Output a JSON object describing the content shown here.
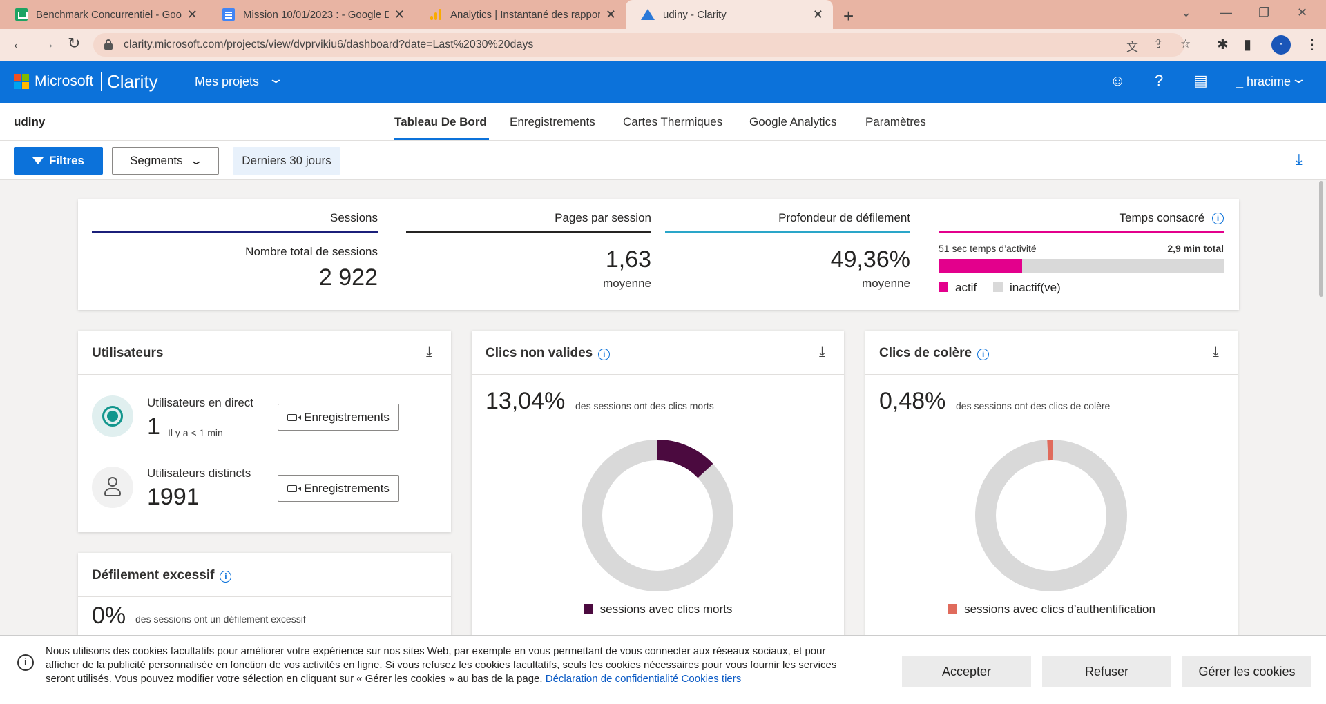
{
  "browser": {
    "tabs": [
      {
        "title": "Benchmark Concurrentiel - Goog",
        "icon": "sheets-icon"
      },
      {
        "title": "Mission 10/01/2023 : - Google D",
        "icon": "docs-icon"
      },
      {
        "title": "Analytics | Instantané des rappor",
        "icon": "analytics-icon"
      },
      {
        "title": "udiny - Clarity",
        "icon": "clarity-icon"
      }
    ],
    "url": "clarity.microsoft.com/projects/view/dvprvikiu6/dashboard?date=Last%2030%20days",
    "profile_initial": "-"
  },
  "header": {
    "brand": "Microsoft",
    "product": "Clarity",
    "projects_menu": "Mes projets",
    "user": "_ hracime"
  },
  "project": {
    "name": "udiny",
    "tabs": [
      "Tableau De Bord",
      "Enregistrements",
      "Cartes Thermiques",
      "Google Analytics",
      "Paramètres"
    ],
    "active_tab": "Tableau De Bord"
  },
  "filters": {
    "filter_label": "Filtres",
    "segments_label": "Segments",
    "date_range": "Derniers 30 jours"
  },
  "summary": {
    "sessions": {
      "title": "Sessions",
      "subtitle": "Nombre total de sessions",
      "value": "2 922"
    },
    "pages_per_session": {
      "title": "Pages par session",
      "value": "1,63",
      "caption": "moyenne"
    },
    "scroll_depth": {
      "title": "Profondeur de défilement",
      "value": "49,36%",
      "caption": "moyenne"
    },
    "time_spent": {
      "title": "Temps consacré",
      "active_label": "51 sec temps d’activité",
      "total_label": "2,9 min total",
      "active_fraction": 0.293,
      "legend_active": "actif",
      "legend_inactive": "inactif(ve)"
    }
  },
  "users": {
    "title": "Utilisateurs",
    "live_label": "Utilisateurs en direct",
    "live_value": "1",
    "live_ago": "Il y a < 1 min",
    "distinct_label": "Utilisateurs distincts",
    "distinct_value": "1991",
    "recordings_label": "Enregistrements"
  },
  "excessive_scroll": {
    "title": "Défilement excessif",
    "value": "0%",
    "desc": "des sessions ont un défilement excessif"
  },
  "dead_clicks": {
    "title": "Clics non valides",
    "value": "13,04%",
    "desc": "des sessions ont des clics morts",
    "fraction": 0.1304,
    "legend": "sessions avec clics morts"
  },
  "rage_clicks": {
    "title": "Clics de colère",
    "value": "0,48%",
    "desc": "des sessions ont des clics de colère",
    "fraction": 0.0048,
    "legend": "sessions avec clics d’authentification"
  },
  "cookie_banner": {
    "text": "Nous utilisons des cookies facultatifs pour améliorer votre expérience sur nos sites Web, par exemple en vous permettant de vous connecter aux réseaux sociaux, et pour afficher de la publicité personnalisée en fonction de vos activités en ligne. Si vous refusez les cookies facultatifs, seuls les cookies nécessaires pour vous fournir les services seront utilisés. Vous pouvez modifier votre sélection en cliquant sur « Gérer les cookies » au bas de la page.",
    "privacy_link": "Déclaration de confidentialité",
    "third_party_link": "Cookies tiers",
    "accept": "Accepter",
    "refuse": "Refuser",
    "manage": "Gérer les cookies"
  },
  "colors": {
    "clarity_blue": "#0c72da",
    "sessions_line": "#1b1f7a",
    "pages_line": "#252423",
    "scroll_line": "#2aa6c9",
    "time_line": "#e3008c",
    "active": "#e3008c",
    "inactive": "#d9d9d9",
    "dead_click": "#4b0a3f",
    "rage_click": "#e06b5c",
    "donut_base": "#d9d9d9"
  }
}
